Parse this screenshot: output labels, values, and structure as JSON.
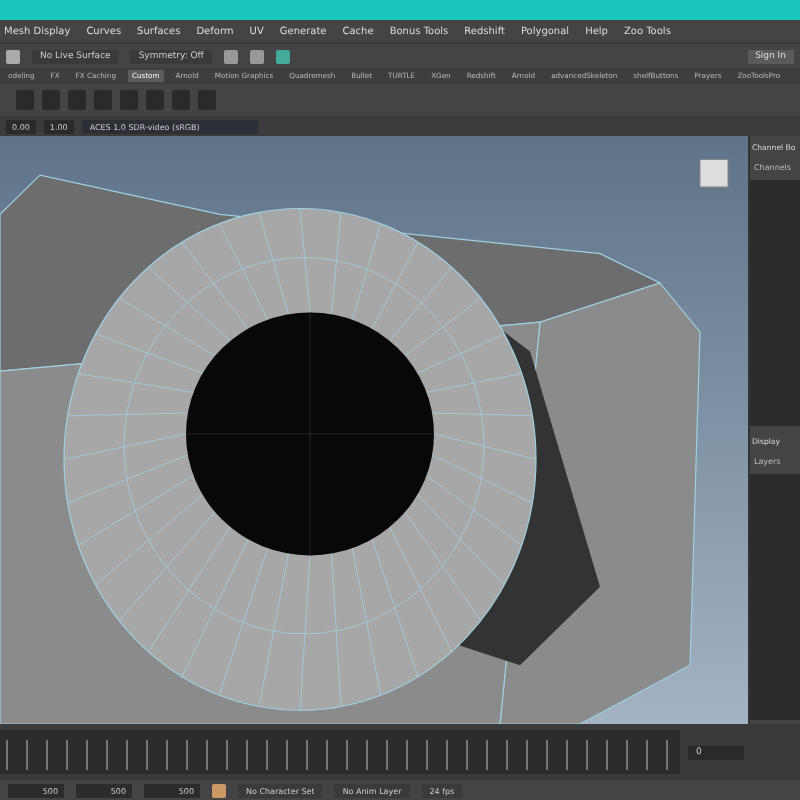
{
  "menu_bar": [
    "Mesh Display",
    "Curves",
    "Surfaces",
    "Deform",
    "UV",
    "Generate",
    "Cache",
    "Bonus Tools",
    "Redshift",
    "Polygonal",
    "Help",
    "Zoo Tools"
  ],
  "status_line": {
    "live_surface": "No Live Surface",
    "symmetry": "Symmetry: Off",
    "sign_in": "Sign In"
  },
  "shelf_tabs": [
    {
      "label": "odeling",
      "selected": false
    },
    {
      "label": "FX",
      "selected": false
    },
    {
      "label": "FX Caching",
      "selected": false
    },
    {
      "label": "Custom",
      "selected": true
    },
    {
      "label": "Arnold",
      "selected": false
    },
    {
      "label": "Motion Graphics",
      "selected": false
    },
    {
      "label": "Quadremesh",
      "selected": false
    },
    {
      "label": "Bullet",
      "selected": false
    },
    {
      "label": "TURTLE",
      "selected": false
    },
    {
      "label": "XGen",
      "selected": false
    },
    {
      "label": "Redshift",
      "selected": false
    },
    {
      "label": "Arnold",
      "selected": false
    },
    {
      "label": "advancedSkeleton",
      "selected": false
    },
    {
      "label": "shelfButtons",
      "selected": false
    },
    {
      "label": "Prayers",
      "selected": false
    },
    {
      "label": "ZooToolsPro",
      "selected": false
    }
  ],
  "viewport_toolbar": {
    "fields": [
      "0.00",
      "1.00"
    ],
    "color_space": "ACES 1.0 SDR-video (sRGB)"
  },
  "channel_box": {
    "title": "Channel Bo",
    "tab": "Channels",
    "lower_title": "Display",
    "lower_tab": "Layers"
  },
  "time_slider": {
    "current_frame": "0"
  },
  "range_slider": {
    "fields": [
      "500",
      "500",
      "500"
    ],
    "character_set": "No Character Set",
    "anim_layer": "No Anim Layer",
    "fps": "24 fps"
  }
}
